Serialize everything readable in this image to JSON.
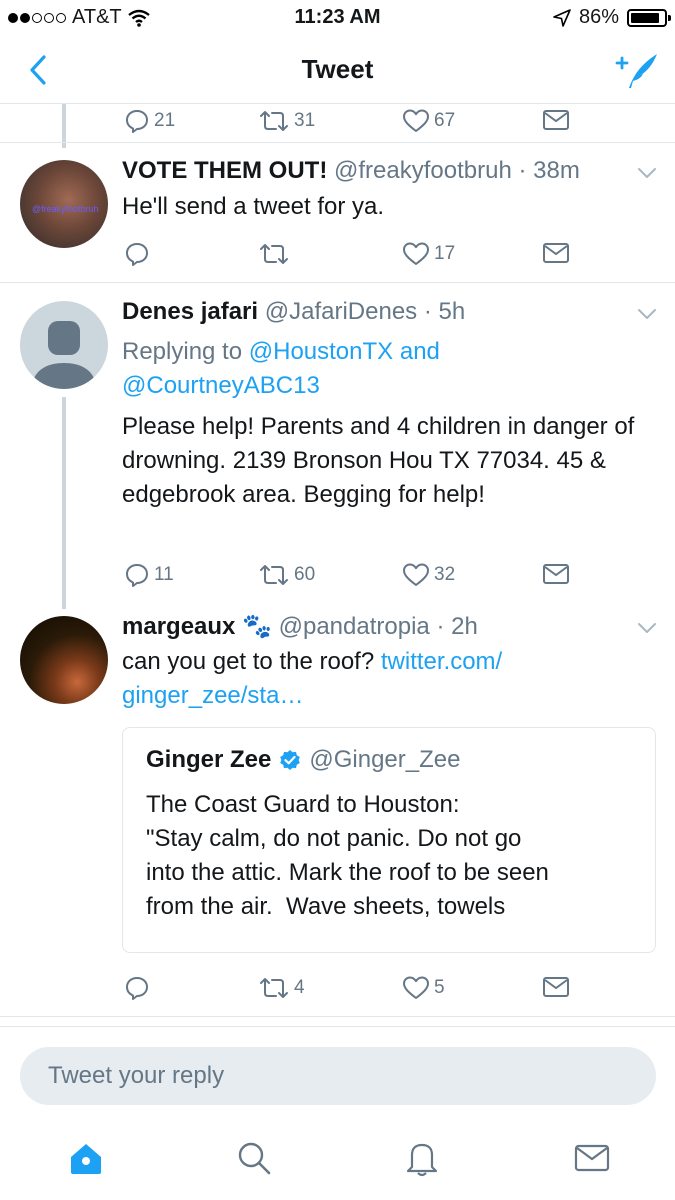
{
  "status_bar": {
    "carrier": "AT&T",
    "signal_bars_filled": 2,
    "signal_bars_total": 5,
    "time": "11:23 AM",
    "battery_percent_label": "86%",
    "battery_level": 0.86
  },
  "nav": {
    "title": "Tweet",
    "accent_color": "#1da1f2"
  },
  "tweets": [
    {
      "actions": {
        "reply_count": "21",
        "retweet_count": "31",
        "like_count": "67"
      }
    },
    {
      "name": "VOTE THEM OUT!",
      "handle": "@freakyfootbruh",
      "time": "· 38m",
      "avatar_watermark": "@freakyfootbruh",
      "text": "He'll send a tweet for ya.",
      "actions": {
        "reply_count": "",
        "retweet_count": "",
        "like_count": "17"
      }
    },
    {
      "name": "Denes jafari",
      "handle": "@JafariDenes",
      "time": "· 5h",
      "replying_prefix": "Replying to",
      "replying_to_1": "@HoustonTX",
      "replying_and": "and",
      "replying_to_2": "@CourtneyABC13",
      "text": "Please help! Parents and 4 children in danger of drowning. 2139 Bronson Hou TX 77034. 45 & edgebrook area. Begging for help!",
      "actions": {
        "reply_count": "11",
        "retweet_count": "60",
        "like_count": "32"
      }
    },
    {
      "name": "margeaux",
      "name_emoji": "🐾",
      "handle": "@pandatropia",
      "time": "· 2h",
      "text": "can you get to the roof?",
      "link_line_1": "twitter.com/",
      "link_line_2": "ginger_zee/sta…",
      "quote": {
        "name": "Ginger Zee",
        "handle": "@Ginger_Zee",
        "verified": true,
        "text_lines": [
          "The Coast Guard to Houston:",
          "\"Stay calm, do not panic. Do not go",
          "into the attic. Mark the roof to be seen",
          "from the air.  Wave sheets, towels"
        ]
      },
      "actions": {
        "reply_count": "",
        "retweet_count": "4",
        "like_count": "5"
      }
    }
  ],
  "reply_bar": {
    "placeholder": "Tweet your reply"
  },
  "tab_bar": {
    "items": [
      "home-icon",
      "search-icon",
      "notifications-icon",
      "messages-icon"
    ],
    "active_color": "#1da1f2",
    "inactive_color": "#657786"
  }
}
